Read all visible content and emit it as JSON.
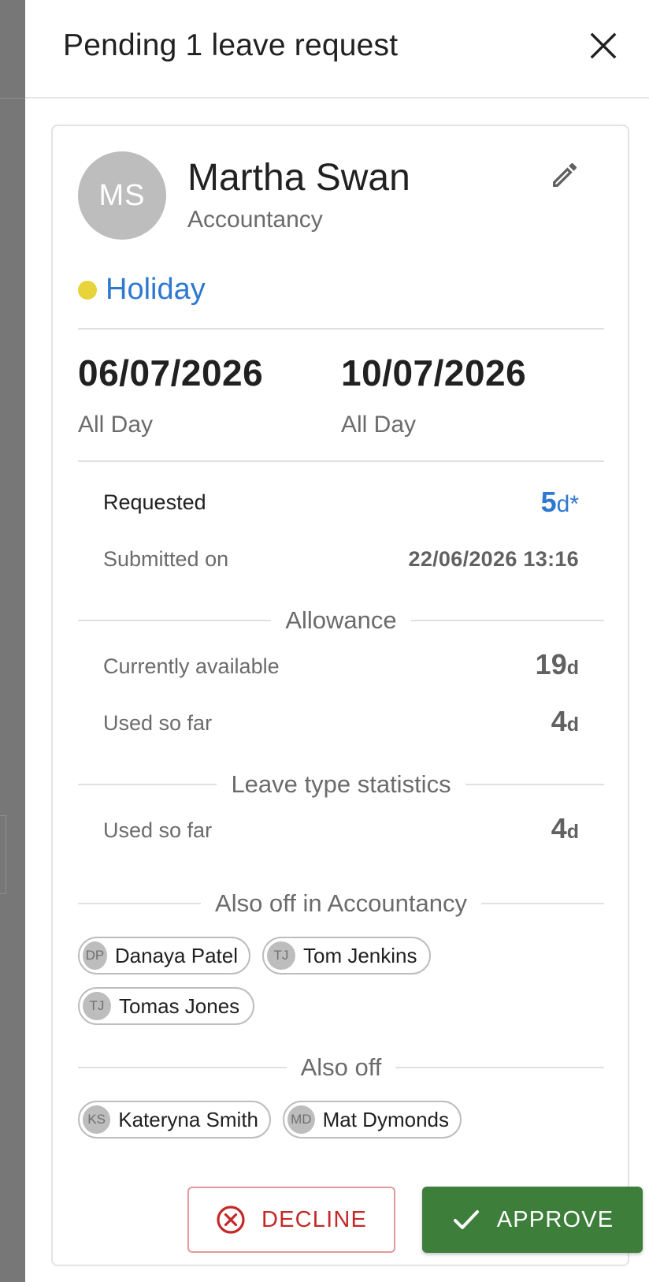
{
  "drawer": {
    "title": "Pending 1 leave request"
  },
  "employee": {
    "initials": "MS",
    "name": "Martha Swan",
    "department": "Accountancy"
  },
  "leave": {
    "type": "Holiday",
    "type_color": "#e6d43a",
    "type_label_color": "#2f78d0",
    "start_date": "06/07/2026",
    "start_period": "All Day",
    "end_date": "10/07/2026",
    "end_period": "All Day"
  },
  "request": {
    "requested_label": "Requested",
    "requested_value": "5",
    "requested_unit": "d*",
    "submitted_label": "Submitted on",
    "submitted_value": "22/06/2026 13:16"
  },
  "allowance": {
    "heading": "Allowance",
    "available_label": "Currently available",
    "available_value": "19",
    "available_unit": "d",
    "used_label": "Used so far",
    "used_value": "4",
    "used_unit": "d"
  },
  "leave_type_stats": {
    "heading": "Leave type statistics",
    "used_label": "Used so far",
    "used_value": "4",
    "used_unit": "d"
  },
  "also_off_department": {
    "heading": "Also off in Accountancy",
    "people": [
      {
        "initials": "DP",
        "name": "Danaya Patel"
      },
      {
        "initials": "TJ",
        "name": "Tom Jenkins"
      },
      {
        "initials": "TJ",
        "name": "Tomas Jones"
      }
    ]
  },
  "also_off": {
    "heading": "Also off",
    "people": [
      {
        "initials": "KS",
        "name": "Kateryna Smith"
      },
      {
        "initials": "MD",
        "name": "Mat Dymonds"
      }
    ]
  },
  "actions": {
    "decline_label": "DECLINE",
    "approve_label": "APPROVE"
  },
  "icons": {
    "close": "close-icon",
    "edit": "pencil-icon",
    "decline": "cancel-circle-icon",
    "approve": "check-icon"
  },
  "colors": {
    "accent_blue": "#2f78d0",
    "approve_green": "#3e7e3b",
    "decline_red": "#c62828"
  }
}
